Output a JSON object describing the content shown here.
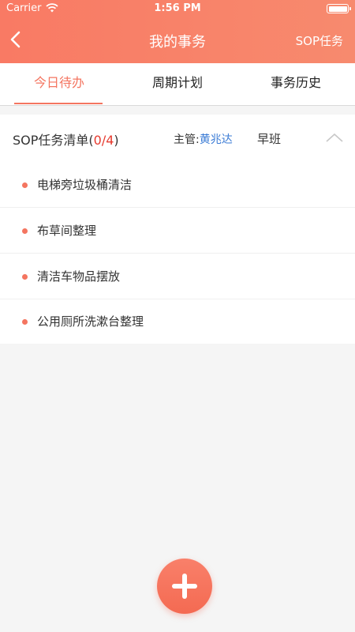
{
  "status_bar": {
    "carrier": "Carrier",
    "time": "1:56 PM"
  },
  "nav": {
    "title": "我的事务",
    "right_label": "SOP任务"
  },
  "tabs": [
    {
      "label": "今日待办",
      "active": true
    },
    {
      "label": "周期计划",
      "active": false
    },
    {
      "label": "事务历史",
      "active": false
    }
  ],
  "sop_card": {
    "title": "SOP任务清单",
    "count": "0/4",
    "supervisor_label": "主管:",
    "supervisor_name": "黄兆达",
    "shift": "早班",
    "tasks": [
      {
        "label": "电梯旁垃圾桶清洁"
      },
      {
        "label": "布草间整理"
      },
      {
        "label": "清洁车物品摆放"
      },
      {
        "label": "公用厕所洗漱台整理"
      }
    ]
  },
  "colors": {
    "accent": "#f47560",
    "header": "#f97a64",
    "supervisor_name": "#3a7bd5",
    "count": "#e63a2e"
  },
  "icons": {
    "back": "chevron-left-icon",
    "collapse": "chevron-up-icon",
    "add": "plus-icon",
    "wifi": "wifi-icon",
    "battery": "battery-icon"
  }
}
